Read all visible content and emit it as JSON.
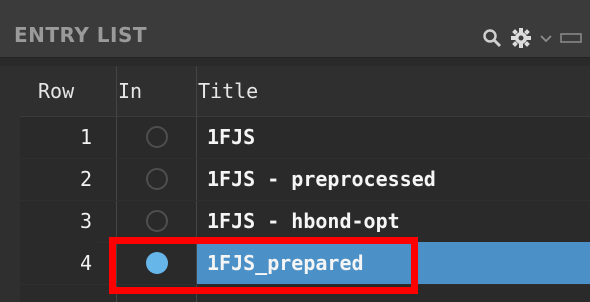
{
  "panel": {
    "title": "ENTRY LIST",
    "tools": [
      "search-icon",
      "gear-icon",
      "chevron-down-icon",
      "minimize-icon"
    ]
  },
  "table": {
    "columns": [
      "Row",
      "In",
      "Title"
    ],
    "rows": [
      {
        "row": "1",
        "in": false,
        "title": "1FJS",
        "selected": false
      },
      {
        "row": "2",
        "in": false,
        "title": "1FJS - preprocessed",
        "selected": false
      },
      {
        "row": "3",
        "in": false,
        "title": "1FJS - hbond-opt",
        "selected": false
      },
      {
        "row": "4",
        "in": true,
        "title": "1FJS_prepared",
        "selected": true
      }
    ]
  },
  "colors": {
    "selection": "#4b90c6",
    "radio_on": "#67b6ea",
    "highlight": "#ff0000"
  }
}
